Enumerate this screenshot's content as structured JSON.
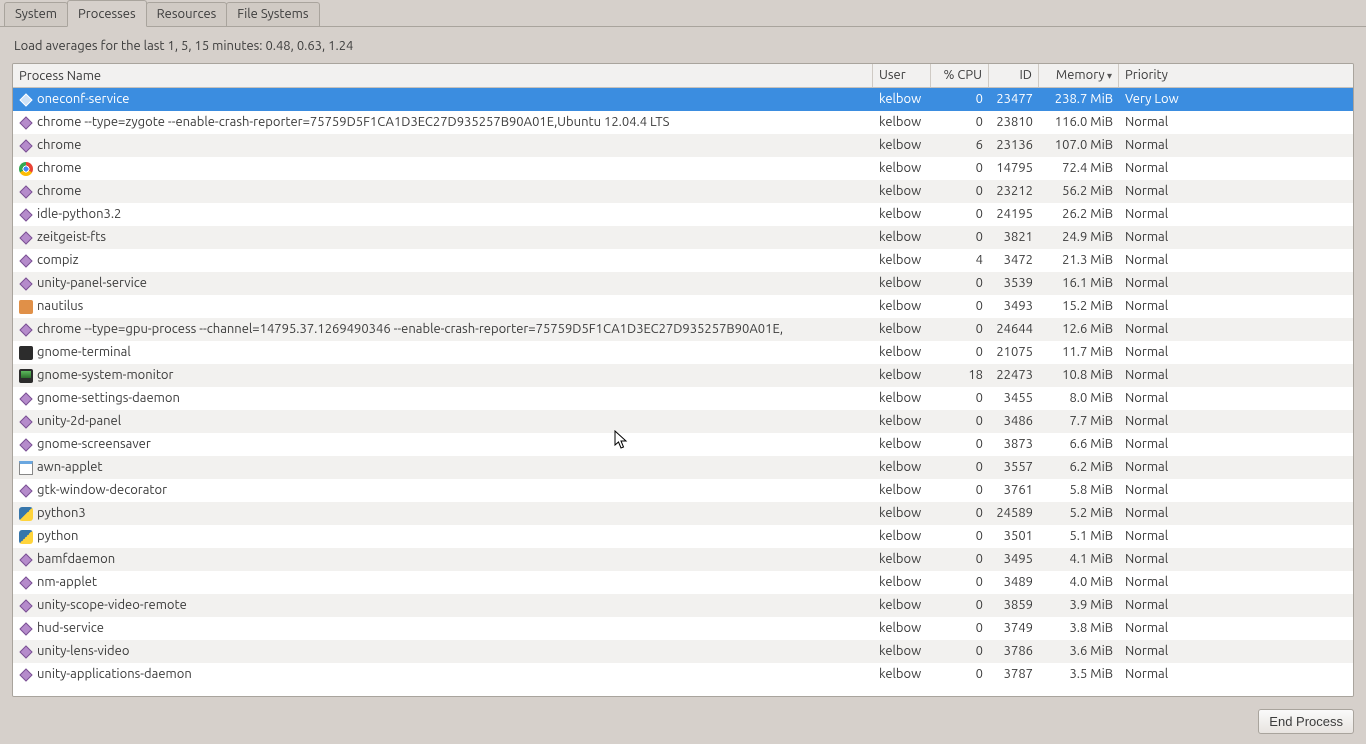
{
  "tabs": [
    "System",
    "Processes",
    "Resources",
    "File Systems"
  ],
  "active_tab": 1,
  "loadavg": "Load averages for the last 1, 5, 15 minutes: 0.48, 0.63, 1.24",
  "columns": [
    {
      "label": "Process Name",
      "key": "name",
      "cls": "col-name"
    },
    {
      "label": "User",
      "key": "user",
      "cls": "col-user"
    },
    {
      "label": "% CPU",
      "key": "cpu",
      "cls": "col-cpu",
      "align": "right"
    },
    {
      "label": "ID",
      "key": "pid",
      "cls": "col-id",
      "align": "right"
    },
    {
      "label": "Memory",
      "key": "mem",
      "cls": "col-mem",
      "align": "right",
      "sort": true
    },
    {
      "label": "Priority",
      "key": "priority",
      "cls": "col-pri"
    }
  ],
  "rows": [
    {
      "icon": "diamond",
      "name": "oneconf-service",
      "user": "kelbow",
      "cpu": 0,
      "pid": 23477,
      "mem": "238.7 MiB",
      "priority": "Very Low",
      "selected": true
    },
    {
      "icon": "diamond",
      "name": "chrome --type=zygote --enable-crash-reporter=75759D5F1CA1D3EC27D935257B90A01E,Ubuntu 12.04.4 LTS",
      "user": "kelbow",
      "cpu": 0,
      "pid": 23810,
      "mem": "116.0 MiB",
      "priority": "Normal"
    },
    {
      "icon": "diamond",
      "name": "chrome",
      "user": "kelbow",
      "cpu": 6,
      "pid": 23136,
      "mem": "107.0 MiB",
      "priority": "Normal"
    },
    {
      "icon": "chrome",
      "name": "chrome",
      "user": "kelbow",
      "cpu": 0,
      "pid": 14795,
      "mem": "72.4 MiB",
      "priority": "Normal"
    },
    {
      "icon": "diamond",
      "name": "chrome",
      "user": "kelbow",
      "cpu": 0,
      "pid": 23212,
      "mem": "56.2 MiB",
      "priority": "Normal"
    },
    {
      "icon": "diamond",
      "name": "idle-python3.2",
      "user": "kelbow",
      "cpu": 0,
      "pid": 24195,
      "mem": "26.2 MiB",
      "priority": "Normal"
    },
    {
      "icon": "diamond",
      "name": "zeitgeist-fts",
      "user": "kelbow",
      "cpu": 0,
      "pid": 3821,
      "mem": "24.9 MiB",
      "priority": "Normal"
    },
    {
      "icon": "diamond",
      "name": "compiz",
      "user": "kelbow",
      "cpu": 4,
      "pid": 3472,
      "mem": "21.3 MiB",
      "priority": "Normal"
    },
    {
      "icon": "diamond",
      "name": "unity-panel-service",
      "user": "kelbow",
      "cpu": 0,
      "pid": 3539,
      "mem": "16.1 MiB",
      "priority": "Normal"
    },
    {
      "icon": "folder",
      "name": "nautilus",
      "user": "kelbow",
      "cpu": 0,
      "pid": 3493,
      "mem": "15.2 MiB",
      "priority": "Normal"
    },
    {
      "icon": "diamond",
      "name": "chrome --type=gpu-process --channel=14795.37.1269490346 --enable-crash-reporter=75759D5F1CA1D3EC27D935257B90A01E,",
      "user": "kelbow",
      "cpu": 0,
      "pid": 24644,
      "mem": "12.6 MiB",
      "priority": "Normal"
    },
    {
      "icon": "terminal",
      "name": "gnome-terminal",
      "user": "kelbow",
      "cpu": 0,
      "pid": 21075,
      "mem": "11.7 MiB",
      "priority": "Normal"
    },
    {
      "icon": "monitor",
      "name": "gnome-system-monitor",
      "user": "kelbow",
      "cpu": 18,
      "pid": 22473,
      "mem": "10.8 MiB",
      "priority": "Normal"
    },
    {
      "icon": "diamond",
      "name": "gnome-settings-daemon",
      "user": "kelbow",
      "cpu": 0,
      "pid": 3455,
      "mem": "8.0 MiB",
      "priority": "Normal"
    },
    {
      "icon": "diamond",
      "name": "unity-2d-panel",
      "user": "kelbow",
      "cpu": 0,
      "pid": 3486,
      "mem": "7.7 MiB",
      "priority": "Normal"
    },
    {
      "icon": "diamond",
      "name": "gnome-screensaver",
      "user": "kelbow",
      "cpu": 0,
      "pid": 3873,
      "mem": "6.6 MiB",
      "priority": "Normal"
    },
    {
      "icon": "window",
      "name": "awn-applet",
      "user": "kelbow",
      "cpu": 0,
      "pid": 3557,
      "mem": "6.2 MiB",
      "priority": "Normal"
    },
    {
      "icon": "diamond",
      "name": "gtk-window-decorator",
      "user": "kelbow",
      "cpu": 0,
      "pid": 3761,
      "mem": "5.8 MiB",
      "priority": "Normal"
    },
    {
      "icon": "python",
      "name": "python3",
      "user": "kelbow",
      "cpu": 0,
      "pid": 24589,
      "mem": "5.2 MiB",
      "priority": "Normal"
    },
    {
      "icon": "python",
      "name": "python",
      "user": "kelbow",
      "cpu": 0,
      "pid": 3501,
      "mem": "5.1 MiB",
      "priority": "Normal"
    },
    {
      "icon": "diamond",
      "name": "bamfdaemon",
      "user": "kelbow",
      "cpu": 0,
      "pid": 3495,
      "mem": "4.1 MiB",
      "priority": "Normal"
    },
    {
      "icon": "diamond",
      "name": "nm-applet",
      "user": "kelbow",
      "cpu": 0,
      "pid": 3489,
      "mem": "4.0 MiB",
      "priority": "Normal"
    },
    {
      "icon": "diamond",
      "name": "unity-scope-video-remote",
      "user": "kelbow",
      "cpu": 0,
      "pid": 3859,
      "mem": "3.9 MiB",
      "priority": "Normal"
    },
    {
      "icon": "diamond",
      "name": "hud-service",
      "user": "kelbow",
      "cpu": 0,
      "pid": 3749,
      "mem": "3.8 MiB",
      "priority": "Normal"
    },
    {
      "icon": "diamond",
      "name": "unity-lens-video",
      "user": "kelbow",
      "cpu": 0,
      "pid": 3786,
      "mem": "3.6 MiB",
      "priority": "Normal"
    },
    {
      "icon": "diamond",
      "name": "unity-applications-daemon",
      "user": "kelbow",
      "cpu": 0,
      "pid": 3787,
      "mem": "3.5 MiB",
      "priority": "Normal"
    }
  ],
  "end_process_label": "End Process"
}
